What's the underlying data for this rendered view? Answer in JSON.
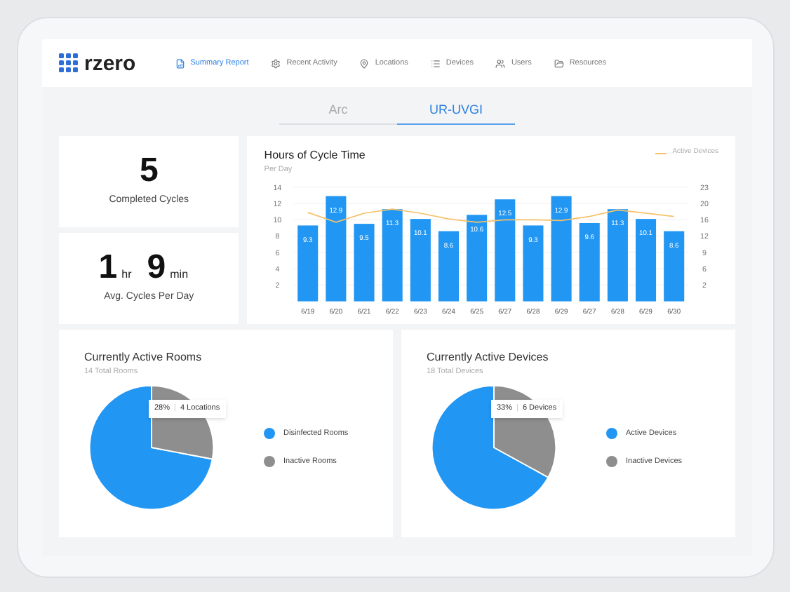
{
  "logo": "rzero",
  "nav": [
    {
      "label": "Summary Report",
      "selected": true
    },
    {
      "label": "Recent Activity",
      "selected": false
    },
    {
      "label": "Locations",
      "selected": false
    },
    {
      "label": "Devices",
      "selected": false
    },
    {
      "label": "Users",
      "selected": false
    },
    {
      "label": "Resources",
      "selected": false
    }
  ],
  "tabs": [
    {
      "label": "Arc",
      "selected": false
    },
    {
      "label": "UR-UVGI",
      "selected": true
    }
  ],
  "stats": [
    {
      "parts": [
        {
          "text": "5",
          "kind": "number"
        }
      ],
      "label": "Completed Cycles"
    },
    {
      "parts": [
        {
          "text": "1",
          "kind": "number"
        },
        {
          "text": "hr",
          "kind": "unit"
        },
        {
          "text": "9",
          "kind": "number"
        },
        {
          "text": "min",
          "kind": "unit"
        }
      ],
      "label": "Avg. Cycles Per Day"
    }
  ],
  "cycle_chart": {
    "subtitle": "Per Day",
    "right_ticks": [
      "23",
      "20",
      "16",
      "12",
      "9",
      "6",
      "2"
    ],
    "chart_data": {
      "type": "bar",
      "title": "Hours of Cycle Time",
      "categories": [
        "6/19",
        "6/20",
        "6/21",
        "6/22",
        "6/23",
        "6/24",
        "6/25",
        "6/27",
        "6/28",
        "6/29",
        "6/27",
        "6/28",
        "6/29",
        "6/30"
      ],
      "series": [
        {
          "type": "bar",
          "color": "#2196f3",
          "data_labels": true,
          "values": [
            9.3,
            12.9,
            9.5,
            11.3,
            10.1,
            8.6,
            10.6,
            12.5,
            9.3,
            12.9,
            9.6,
            11.3,
            10.1,
            8.6
          ]
        },
        {
          "type": "line",
          "name": "Active Devices",
          "color": "#f5c26b",
          "values": [
            10.9,
            9.7,
            10.8,
            11.3,
            10.8,
            10.1,
            9.7,
            10.0,
            10.0,
            9.9,
            10.4,
            11.2,
            10.8,
            10.4
          ]
        }
      ],
      "ylim": [
        0,
        14
      ],
      "yticks": [
        2,
        4,
        6,
        8,
        10,
        12,
        14
      ],
      "grid": true
    }
  },
  "pies": [
    {
      "subtitle": "14 Total Rooms",
      "tooltip_percent": "28%",
      "tooltip_separator": "|",
      "tooltip_count": "4 Locations",
      "chart_data": {
        "type": "pie",
        "title": "Currently Active Rooms",
        "categories": [
          "Disinfected Rooms",
          "Inactive Rooms"
        ],
        "colors": [
          "#2196f3",
          "#8e8e8e"
        ],
        "values": [
          72,
          28
        ]
      }
    },
    {
      "subtitle": "18 Total Devices",
      "tooltip_percent": "33%",
      "tooltip_separator": "|",
      "tooltip_count": "6 Devices",
      "chart_data": {
        "type": "pie",
        "title": "Currently Active Devices",
        "categories": [
          "Active Devices",
          "Inactive Devices"
        ],
        "colors": [
          "#2196f3",
          "#8e8e8e"
        ],
        "values": [
          67,
          33
        ]
      }
    }
  ]
}
